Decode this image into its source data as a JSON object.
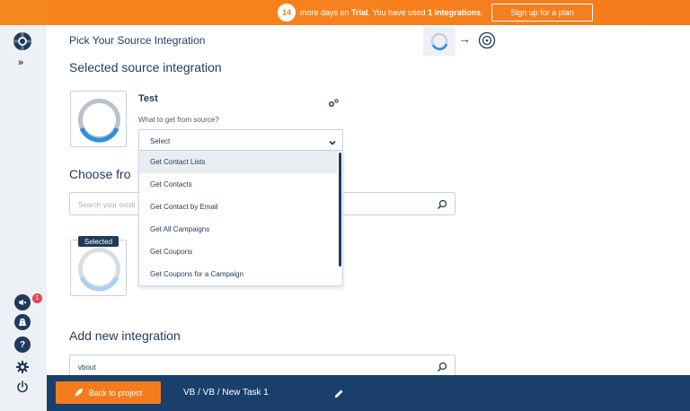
{
  "banner": {
    "days": "14",
    "msg_pre": "more days on ",
    "trial_word": "Trial",
    "msg_mid": ". You have used ",
    "used_count": "1 integrations",
    "msg_end": ".",
    "signup_label": "Sign up for a plan"
  },
  "sidebar": {
    "expand_icon": "»",
    "notification_count": "1"
  },
  "header": {
    "title": "Pick Your Source Integration",
    "step_arrow": "→"
  },
  "selected_section": {
    "heading": "Selected source integration",
    "name": "Test",
    "get_label": "What to get from source?",
    "select_value": "Select",
    "options": [
      "Get Contact Lists",
      "Get Contacts",
      "Get Contact by Email",
      "Get All Campaigns",
      "Get Coupons",
      "Get Coupons for a Campaign"
    ]
  },
  "choose_section": {
    "heading_visible": "Choose fro",
    "search_placeholder": "Search your existi",
    "selected_badge": "Selected"
  },
  "add_section": {
    "heading": "Add new integration",
    "search_value": "vbout"
  },
  "bottom": {
    "back_label": "Back to project",
    "breadcrumb": "VB / VB / New Task 1"
  },
  "colors": {
    "accent_orange": "#f57c1d",
    "navy": "#1f3a5a",
    "bottom_bar": "#1a3f6b",
    "notif_red": "#e4465b"
  }
}
